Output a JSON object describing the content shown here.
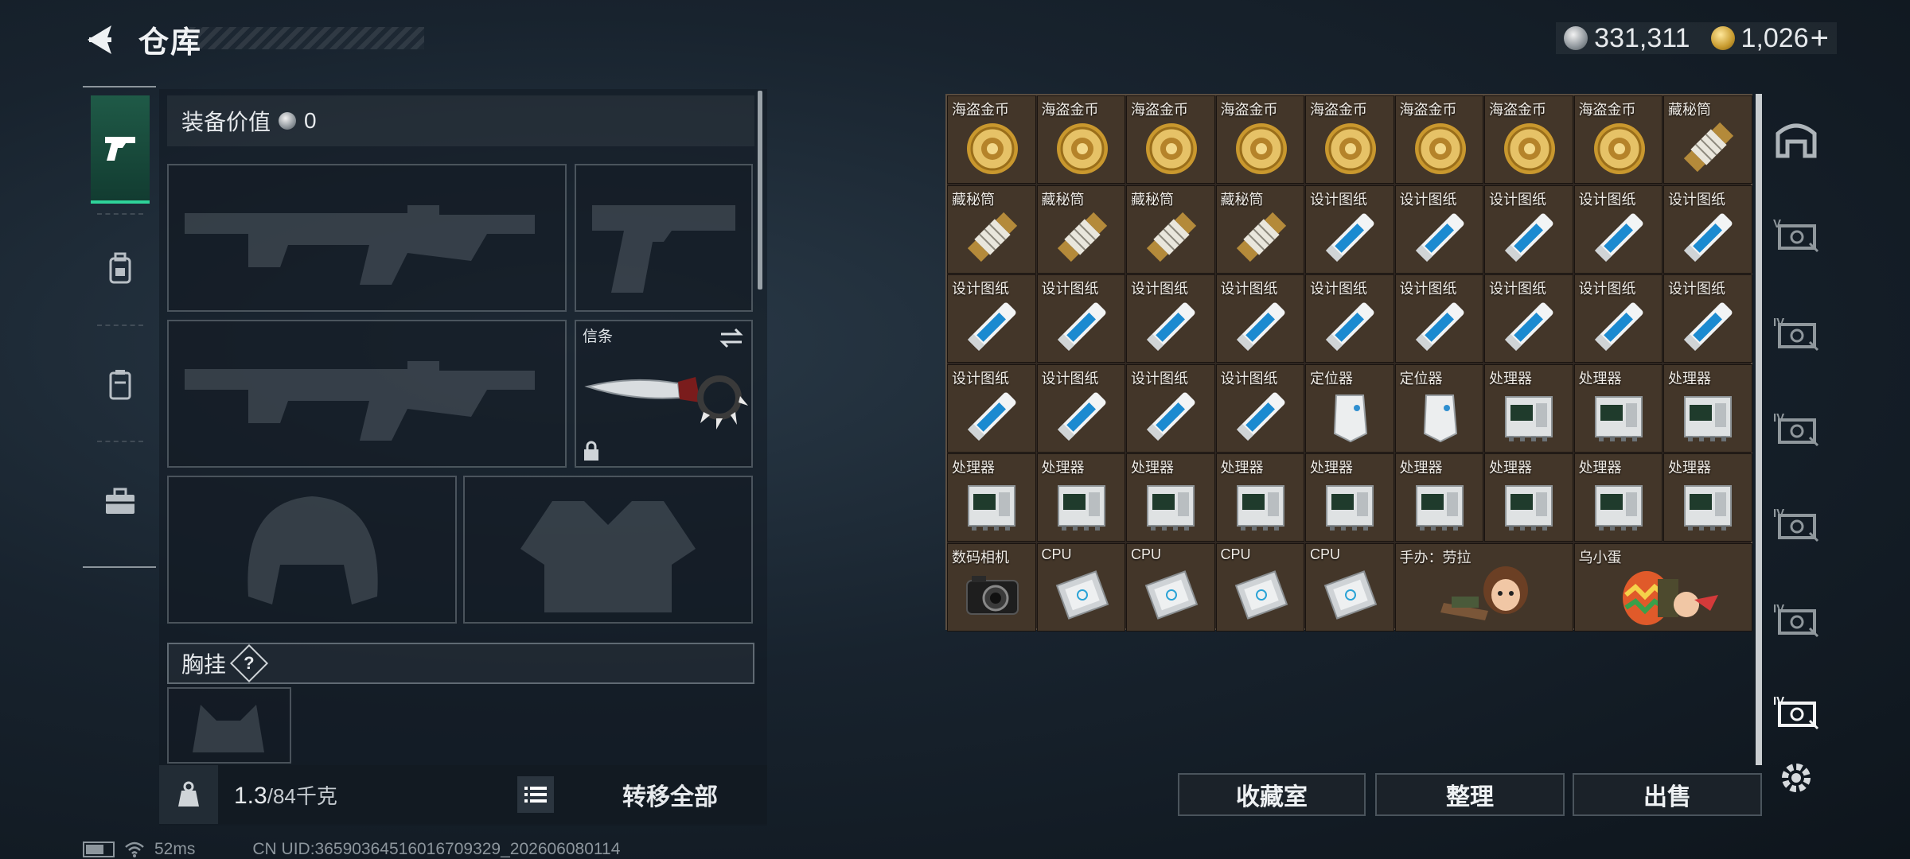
{
  "header": {
    "title": "仓库",
    "silver_amount": "331,311",
    "gold_amount": "1,026",
    "gold_plus": "+"
  },
  "left_tabs": [
    {
      "name": "weapons",
      "icon": "pistol-icon",
      "active": true
    },
    {
      "name": "armor",
      "icon": "backpack-icon",
      "active": false
    },
    {
      "name": "case",
      "icon": "container-icon",
      "active": false
    },
    {
      "name": "kit",
      "icon": "briefcase-icon",
      "active": false
    }
  ],
  "loadout": {
    "equip_value_label": "装备价值",
    "equip_value": "0",
    "melee_slot_label": "信条",
    "chest_rig_label": "胸挂",
    "chest_rig_help": "?",
    "weight_current": "1.3",
    "weight_capacity": "/84千克",
    "move_all_label": "转移全部"
  },
  "storage": {
    "columns": 9,
    "items": [
      {
        "label": "海盗金币",
        "icon": "coin"
      },
      {
        "label": "海盗金币",
        "icon": "coin"
      },
      {
        "label": "海盗金币",
        "icon": "coin"
      },
      {
        "label": "海盗金币",
        "icon": "coin"
      },
      {
        "label": "海盗金币",
        "icon": "coin"
      },
      {
        "label": "海盗金币",
        "icon": "coin"
      },
      {
        "label": "海盗金币",
        "icon": "coin"
      },
      {
        "label": "海盗金币",
        "icon": "coin"
      },
      {
        "label": "藏秘筒",
        "icon": "cryptex"
      },
      {
        "label": "藏秘筒",
        "icon": "cryptex"
      },
      {
        "label": "藏秘筒",
        "icon": "cryptex"
      },
      {
        "label": "藏秘筒",
        "icon": "cryptex"
      },
      {
        "label": "藏秘筒",
        "icon": "cryptex"
      },
      {
        "label": "设计图纸",
        "icon": "blueprint"
      },
      {
        "label": "设计图纸",
        "icon": "blueprint"
      },
      {
        "label": "设计图纸",
        "icon": "blueprint"
      },
      {
        "label": "设计图纸",
        "icon": "blueprint"
      },
      {
        "label": "设计图纸",
        "icon": "blueprint"
      },
      {
        "label": "设计图纸",
        "icon": "blueprint"
      },
      {
        "label": "设计图纸",
        "icon": "blueprint"
      },
      {
        "label": "设计图纸",
        "icon": "blueprint"
      },
      {
        "label": "设计图纸",
        "icon": "blueprint"
      },
      {
        "label": "设计图纸",
        "icon": "blueprint"
      },
      {
        "label": "设计图纸",
        "icon": "blueprint"
      },
      {
        "label": "设计图纸",
        "icon": "blueprint"
      },
      {
        "label": "设计图纸",
        "icon": "blueprint"
      },
      {
        "label": "设计图纸",
        "icon": "blueprint"
      },
      {
        "label": "设计图纸",
        "icon": "blueprint"
      },
      {
        "label": "设计图纸",
        "icon": "blueprint"
      },
      {
        "label": "设计图纸",
        "icon": "blueprint"
      },
      {
        "label": "设计图纸",
        "icon": "blueprint"
      },
      {
        "label": "定位器",
        "icon": "locator"
      },
      {
        "label": "定位器",
        "icon": "locator"
      },
      {
        "label": "处理器",
        "icon": "processor"
      },
      {
        "label": "处理器",
        "icon": "processor"
      },
      {
        "label": "处理器",
        "icon": "processor"
      },
      {
        "label": "处理器",
        "icon": "processor"
      },
      {
        "label": "处理器",
        "icon": "processor"
      },
      {
        "label": "处理器",
        "icon": "processor"
      },
      {
        "label": "处理器",
        "icon": "processor"
      },
      {
        "label": "处理器",
        "icon": "processor"
      },
      {
        "label": "处理器",
        "icon": "processor"
      },
      {
        "label": "处理器",
        "icon": "processor"
      },
      {
        "label": "处理器",
        "icon": "processor"
      },
      {
        "label": "处理器",
        "icon": "processor"
      },
      {
        "label": "数码相机",
        "icon": "camera"
      },
      {
        "label": "CPU",
        "icon": "cpu"
      },
      {
        "label": "CPU",
        "icon": "cpu"
      },
      {
        "label": "CPU",
        "icon": "cpu"
      },
      {
        "label": "CPU",
        "icon": "cpu"
      },
      {
        "label": "手办：劳拉",
        "icon": "figure-lara",
        "wide": true
      },
      {
        "label": "乌小蛋",
        "icon": "figure-egg",
        "wide": true
      }
    ]
  },
  "right_rail": [
    {
      "icon": "vault-icon"
    },
    {
      "icon": "case-v-icon"
    },
    {
      "icon": "case-iv-icon"
    },
    {
      "icon": "case-iv-icon"
    },
    {
      "icon": "case-iv-icon"
    },
    {
      "icon": "case-iv-icon"
    },
    {
      "icon": "case-iv-icon"
    },
    {
      "icon": "gear-icon"
    }
  ],
  "bottom_buttons": {
    "collection": "收藏室",
    "sort": "整理",
    "sell": "出售"
  },
  "status_bar": {
    "ping": "52ms",
    "uid": "CN UID:36590364516016709329_202606080114"
  }
}
